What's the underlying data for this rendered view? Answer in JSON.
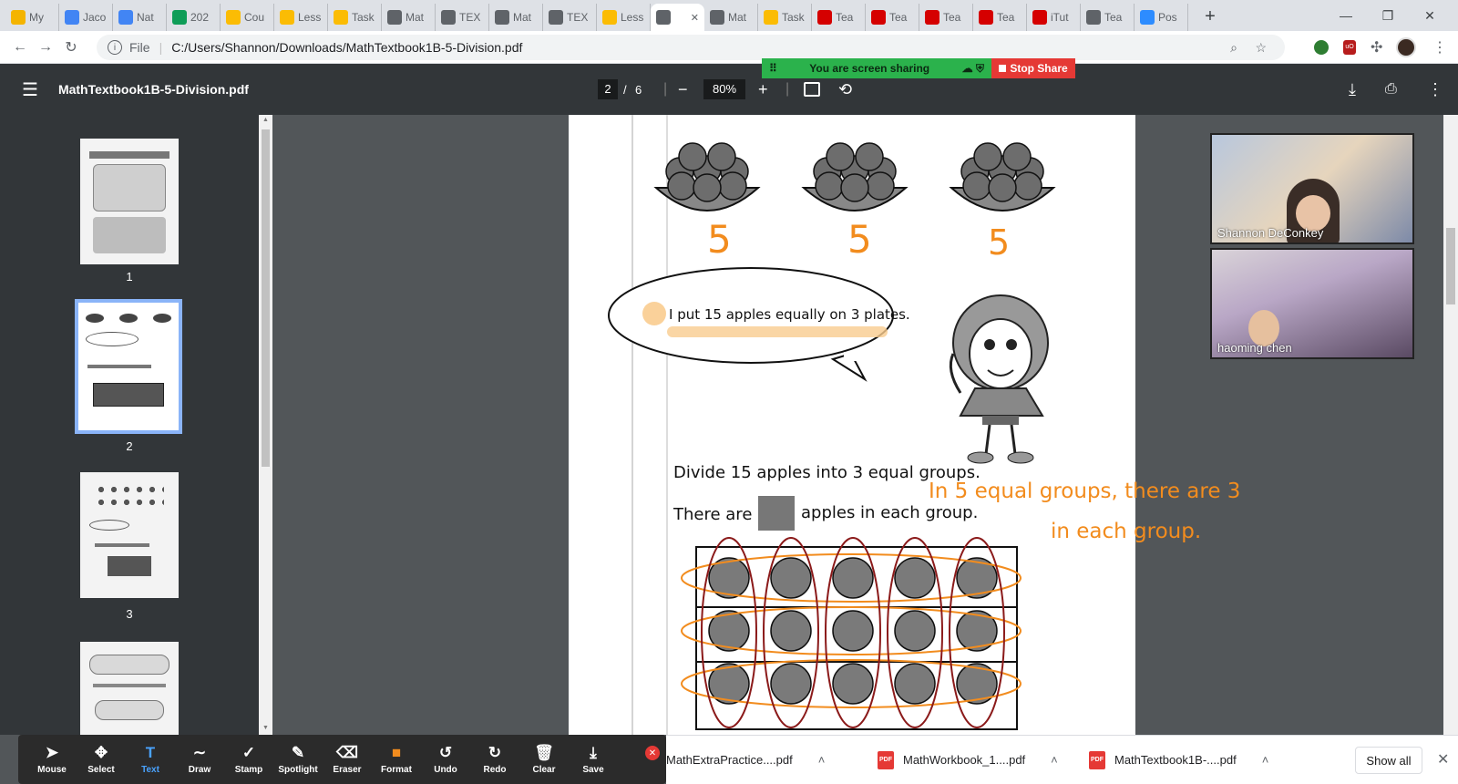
{
  "browser": {
    "tabs": [
      {
        "label": "My",
        "icon": "drive-icon",
        "color": "#f4b400"
      },
      {
        "label": "Jaco",
        "icon": "docs-icon",
        "color": "#4285f4"
      },
      {
        "label": "Nat",
        "icon": "docs-icon",
        "color": "#4285f4"
      },
      {
        "label": "202",
        "icon": "sheets-icon",
        "color": "#0f9d58"
      },
      {
        "label": "Cou",
        "icon": "classroom-icon",
        "color": "#fbbc04"
      },
      {
        "label": "Less",
        "icon": "classroom-icon",
        "color": "#fbbc04"
      },
      {
        "label": "Task",
        "icon": "classroom-icon",
        "color": "#fbbc04"
      },
      {
        "label": "Mat",
        "icon": "globe-icon",
        "color": "#5f6368"
      },
      {
        "label": "TEX",
        "icon": "globe-icon",
        "color": "#5f6368"
      },
      {
        "label": "Mat",
        "icon": "globe-icon",
        "color": "#5f6368"
      },
      {
        "label": "TEX",
        "icon": "globe-icon",
        "color": "#5f6368"
      },
      {
        "label": "Less",
        "icon": "classroom-icon",
        "color": "#fbbc04"
      },
      {
        "label": "",
        "icon": "globe-icon",
        "color": "#5f6368",
        "active": true
      },
      {
        "label": "Mat",
        "icon": "globe-icon",
        "color": "#5f6368"
      },
      {
        "label": "Task",
        "icon": "classroom-icon",
        "color": "#fbbc04"
      },
      {
        "label": "Tea",
        "icon": "itutor-icon",
        "color": "#d50000"
      },
      {
        "label": "Tea",
        "icon": "itutor-icon",
        "color": "#d50000"
      },
      {
        "label": "Tea",
        "icon": "itutor-icon",
        "color": "#d50000"
      },
      {
        "label": "Tea",
        "icon": "itutor-icon",
        "color": "#d50000"
      },
      {
        "label": "iTut",
        "icon": "itutor-icon",
        "color": "#d50000"
      },
      {
        "label": "Tea",
        "icon": "globe-icon",
        "color": "#5f6368"
      },
      {
        "label": "Pos",
        "icon": "zoom-icon",
        "color": "#2d8cff"
      }
    ],
    "address_file": "File",
    "address": "C:/Users/Shannon/Downloads/MathTextbook1B-5-Division.pdf"
  },
  "pdf": {
    "title": "MathTextbook1B-5-Division.pdf",
    "current_page": "2",
    "separator": "/",
    "total_pages": "6",
    "zoom": "80%"
  },
  "screen_share": {
    "status": "You are screen sharing",
    "stop": "Stop Share"
  },
  "thumbnails": [
    {
      "number": "1"
    },
    {
      "number": "2"
    },
    {
      "number": "3"
    }
  ],
  "page": {
    "handwritten_counts": [
      "5",
      "5",
      "5"
    ],
    "speech": "I put 15 apples equally on 3 plates.",
    "line1": "Divide 15 apples into 3 equal groups.",
    "line2_before": "There are",
    "line2_after": "apples in each group.",
    "annotation_line1": "In 5 equal groups, there are 3",
    "annotation_line2": "in each group."
  },
  "video": [
    {
      "name": "Shannon DeConkey"
    },
    {
      "name": "haoming chen"
    }
  ],
  "annotate_tools": [
    {
      "label": "Mouse",
      "icon": "cursor-icon",
      "glyph": "➤"
    },
    {
      "label": "Select",
      "icon": "move-icon",
      "glyph": "✥"
    },
    {
      "label": "Text",
      "icon": "text-icon",
      "glyph": "T"
    },
    {
      "label": "Draw",
      "icon": "draw-icon",
      "glyph": "∼"
    },
    {
      "label": "Stamp",
      "icon": "stamp-icon",
      "glyph": "✓"
    },
    {
      "label": "Spotlight",
      "icon": "spotlight-icon",
      "glyph": "✎"
    },
    {
      "label": "Eraser",
      "icon": "eraser-icon",
      "glyph": "⌫"
    },
    {
      "label": "Format",
      "icon": "format-icon",
      "glyph": "■"
    },
    {
      "label": "Undo",
      "icon": "undo-icon",
      "glyph": "↺"
    },
    {
      "label": "Redo",
      "icon": "redo-icon",
      "glyph": "↻"
    },
    {
      "label": "Clear",
      "icon": "trash-icon",
      "glyph": "🗑"
    },
    {
      "label": "Save",
      "icon": "save-icon",
      "glyph": "⤓"
    }
  ],
  "downloads": {
    "items": [
      {
        "name": "MathExtraPractice....pdf"
      },
      {
        "name": "MathWorkbook_1....pdf"
      },
      {
        "name": "MathTextbook1B-....pdf"
      }
    ],
    "show_all": "Show all"
  },
  "colors": {
    "annotation_orange": "#f28c1e",
    "circle_red": "#8b1a1a",
    "active_text_tool": "#4aa3ff"
  }
}
